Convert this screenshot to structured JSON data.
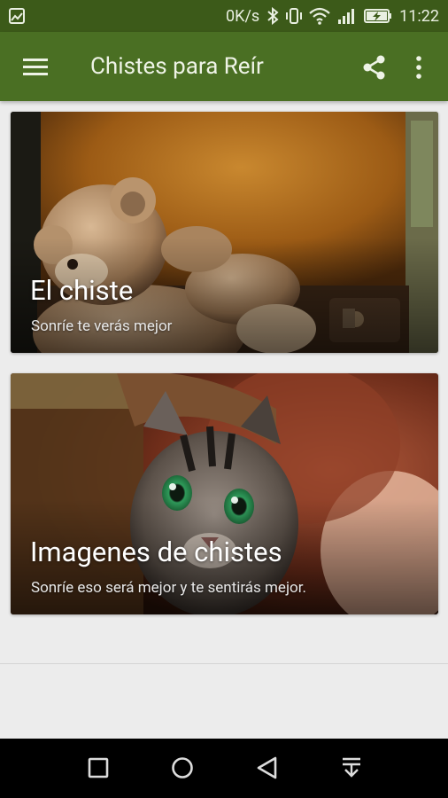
{
  "status_bar": {
    "speed": "0K/s",
    "time": "11:22",
    "icons": [
      "image-icon",
      "bluetooth-icon",
      "vibrate-icon",
      "wifi-icon",
      "signal-icon",
      "battery-charging-icon"
    ]
  },
  "app_bar": {
    "title": "Chistes para Reír",
    "icons": [
      "menu-icon",
      "share-icon",
      "more-vert-icon"
    ]
  },
  "cards": [
    {
      "title": "El chiste",
      "subtitle": "Sonríe te verás mejor",
      "image": "teddy-bear-in-suitcase"
    },
    {
      "title": "Imagenes de chistes",
      "subtitle": "Sonríe eso será mejor y te sentirás mejor.",
      "image": "kitten-under-blanket"
    }
  ],
  "nav_bar": {
    "icons": [
      "recents-square-icon",
      "home-circle-icon",
      "back-triangle-icon",
      "notification-pull-icon"
    ]
  },
  "colors": {
    "status_bar": "#3c5a19",
    "app_bar": "#4a6f23",
    "background": "#ececec",
    "nav_bar": "#000000"
  }
}
